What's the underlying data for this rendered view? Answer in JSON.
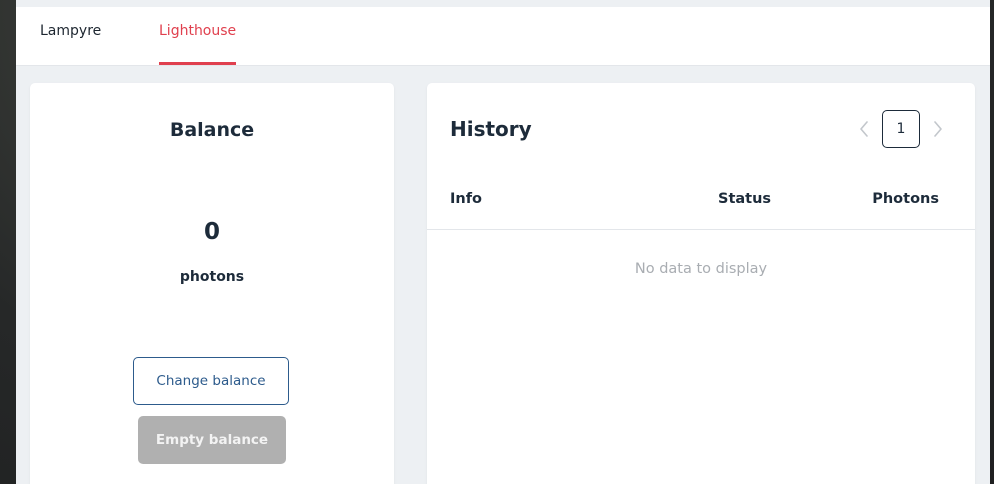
{
  "tabs": [
    {
      "label": "Lampyre",
      "active": false
    },
    {
      "label": "Lighthouse",
      "active": true
    }
  ],
  "colors": {
    "accent": "#e0404e",
    "primary_text": "#1d2b3a",
    "button_outline": "#2d5b8c",
    "button_disabled_bg": "#b0b0b0",
    "muted_text": "#a9adb2"
  },
  "balance": {
    "title": "Balance",
    "value": "0",
    "unit": "photons",
    "change_button": "Change balance",
    "empty_button": "Empty balance"
  },
  "history": {
    "title": "History",
    "pagination": {
      "current_page": "1",
      "prev_icon": "chevron-left-icon",
      "next_icon": "chevron-right-icon"
    },
    "columns": [
      "Info",
      "Status",
      "Photons"
    ],
    "rows": [],
    "empty_text": "No data to display"
  }
}
